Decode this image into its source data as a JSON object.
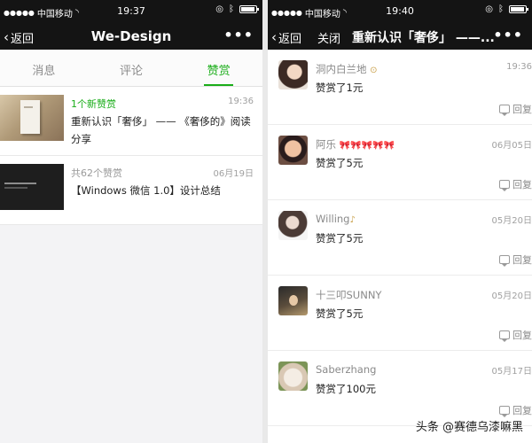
{
  "left": {
    "status": {
      "signal": "●●●●●",
      "carrier": "中国移动",
      "time": "19:37"
    },
    "nav": {
      "back_label": "返回",
      "title": "We-Design",
      "more": "•••"
    },
    "tabs": [
      {
        "label": "消息",
        "active": false
      },
      {
        "label": "评论",
        "active": false
      },
      {
        "label": "赞赏",
        "active": true
      }
    ],
    "notices": [
      {
        "count": "1个新赞赏",
        "date": "19:36",
        "title": "重新认识「奢侈」 —— 《奢侈的》阅读分享",
        "highlight": true
      },
      {
        "count": "共62个赞赏",
        "date": "06月19日",
        "title": "【Windows 微信 1.0】设计总结",
        "highlight": false
      }
    ]
  },
  "right": {
    "status": {
      "signal": "●●●●●",
      "carrier": "中国移动",
      "time": "19:40"
    },
    "nav": {
      "back_label": "返回",
      "close_label": "关闭",
      "title": "重新认识「奢侈」 ——...",
      "more": "•••"
    },
    "reply_label": "回复",
    "comments": [
      {
        "name": "洞内白兰地",
        "emoji": "⊙",
        "text": "赞赏了1元",
        "date": "19:36"
      },
      {
        "name": "阿乐",
        "emoji": "🎀🎀🎀🎀🎀",
        "text": "赞赏了5元",
        "date": "06月05日"
      },
      {
        "name": "Willing",
        "emoji": "♪",
        "text": "赞赏了5元",
        "date": "05月20日"
      },
      {
        "name": "十三叩SUNNY",
        "emoji": "",
        "text": "赞赏了5元",
        "date": "05月20日"
      },
      {
        "name": "Saberzhang",
        "emoji": "",
        "text": "赞赏了100元",
        "date": "05月17日"
      }
    ]
  },
  "watermark": "头条 @赛德乌漆嘛黑",
  "colors": {
    "accent": "#1aad19",
    "bar": "#141414"
  }
}
